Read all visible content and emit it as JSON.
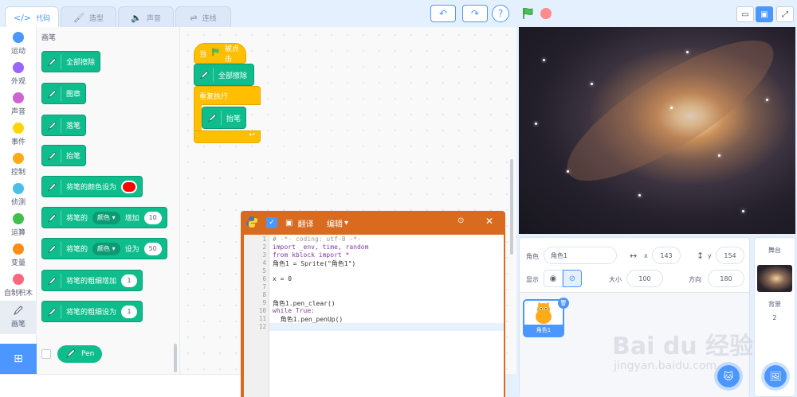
{
  "tabs": [
    {
      "label": "代码",
      "icon": "code-icon"
    },
    {
      "label": "造型",
      "icon": "brush-icon"
    },
    {
      "label": "声音",
      "icon": "speaker-icon"
    },
    {
      "label": "连线",
      "icon": "connect-icon"
    }
  ],
  "toolbar": {
    "undo": "↶",
    "redo": "↷",
    "help": "?"
  },
  "categories": [
    {
      "label": "运动",
      "color": "#4c97ff"
    },
    {
      "label": "外观",
      "color": "#9966ff"
    },
    {
      "label": "声音",
      "color": "#cf63cf"
    },
    {
      "label": "事件",
      "color": "#ffd500"
    },
    {
      "label": "控制",
      "color": "#ffab19"
    },
    {
      "label": "侦测",
      "color": "#4cbfe6"
    },
    {
      "label": "运算",
      "color": "#40bf4a"
    },
    {
      "label": "变量",
      "color": "#ff8c1a"
    },
    {
      "label": "自制积木",
      "color": "#ff6680"
    },
    {
      "label": "画笔",
      "icon": "pen-icon"
    }
  ],
  "palette": {
    "title": "画笔",
    "blocks": {
      "clear": "全部擦除",
      "stamp": "图章",
      "pen_down": "落笔",
      "pen_up": "抬笔",
      "set_color": "将笔的颜色设为",
      "change_param_pre": "将笔的",
      "param_dropdown": "颜色",
      "change_by": "增加",
      "change_value": "10",
      "set_param_pre": "将笔的",
      "set_to": "设为",
      "set_value": "50",
      "size_change": "将笔的粗细增加",
      "size_change_value": "1",
      "size_set": "将笔的粗细设为",
      "size_set_value": "1"
    },
    "extension_label": "Pen"
  },
  "script": {
    "when_flag_pre": "当",
    "when_flag_post": "被点击",
    "clear": "全部擦除",
    "forever": "重复执行",
    "pen_up": "抬笔"
  },
  "code_window": {
    "translate": "翻译",
    "edit": "编辑",
    "lines": [
      "# -*- coding: utf-8 -*-",
      "import _env, time, random",
      "from kblock import *",
      "角色1 = Sprite(\"角色1\")",
      "",
      "x = 0",
      "",
      "",
      "角色1.pen_clear()",
      "while True:",
      "  角色1.pen_penUp()",
      ""
    ],
    "line_numbers": [
      "1",
      "2",
      "3",
      "4",
      "5",
      "6",
      "7",
      "8",
      "9",
      "10",
      "11",
      "12"
    ]
  },
  "sprite_info": {
    "sprite_label": "角色",
    "sprite_name": "角色1",
    "x_label": "x",
    "x_value": "143",
    "y_label": "y",
    "y_value": "154",
    "show_label": "显示",
    "size_label": "大小",
    "size_value": "100",
    "direction_label": "方向",
    "direction_value": "180",
    "sprite_thumb_name": "角色1"
  },
  "stage_panel": {
    "title": "舞台",
    "backdrop_label": "背景",
    "backdrop_count": "2"
  },
  "watermark": {
    "main": "Bai du 经验",
    "sub": "jingyan.baidu.com"
  }
}
